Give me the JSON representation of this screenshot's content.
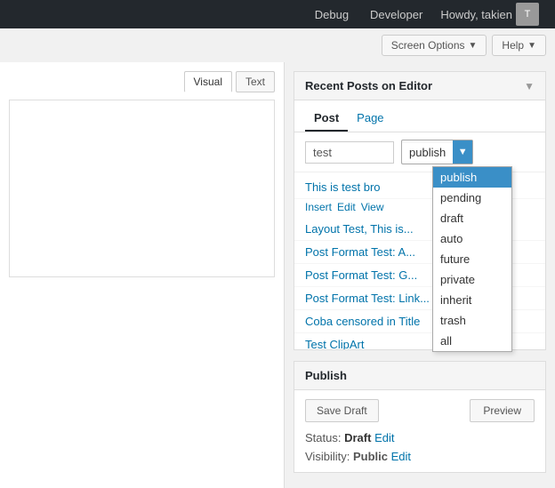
{
  "adminBar": {
    "debug_label": "Debug",
    "developer_label": "Developer",
    "howdy_label": "Howdy, takien",
    "avatar_text": "T"
  },
  "subToolbar": {
    "screen_options_label": "Screen Options",
    "screen_options_chevron": "▼",
    "help_label": "Help",
    "help_chevron": "▼"
  },
  "editor": {
    "tab_visual": "Visual",
    "tab_text": "Text",
    "content": ""
  },
  "recentPosts": {
    "title": "Recent Posts on Editor",
    "collapse_icon": "▼",
    "tab_post": "Post",
    "tab_page": "Page",
    "search_value": "test",
    "status_value": "publish",
    "dropdown_options": [
      {
        "label": "publish",
        "selected": true
      },
      {
        "label": "pending",
        "selected": false
      },
      {
        "label": "draft",
        "selected": false
      },
      {
        "label": "auto",
        "selected": false
      },
      {
        "label": "future",
        "selected": false
      },
      {
        "label": "private",
        "selected": false
      },
      {
        "label": "inherit",
        "selected": false
      },
      {
        "label": "trash",
        "selected": false
      },
      {
        "label": "all",
        "selected": false
      }
    ],
    "posts": [
      {
        "title": "This is test bro",
        "actions": [
          "Insert",
          "Edit",
          "View"
        ]
      },
      {
        "title": "Layout Test, This is..."
      },
      {
        "title": "Post Format Test: A..."
      },
      {
        "title": "Post Format Test: G..."
      },
      {
        "title": "Post Format Test: Link..."
      },
      {
        "title": "Coba censored in Title"
      },
      {
        "title": "Test ClipArt"
      }
    ]
  },
  "publish": {
    "title": "Publish",
    "save_draft_label": "Save Draft",
    "preview_label": "Preview",
    "status_label": "Status:",
    "status_value": "Draft",
    "status_edit": "Edit",
    "visibility_label": "Visibility:",
    "visibility_value": "Public",
    "visibility_edit": "Edit"
  }
}
